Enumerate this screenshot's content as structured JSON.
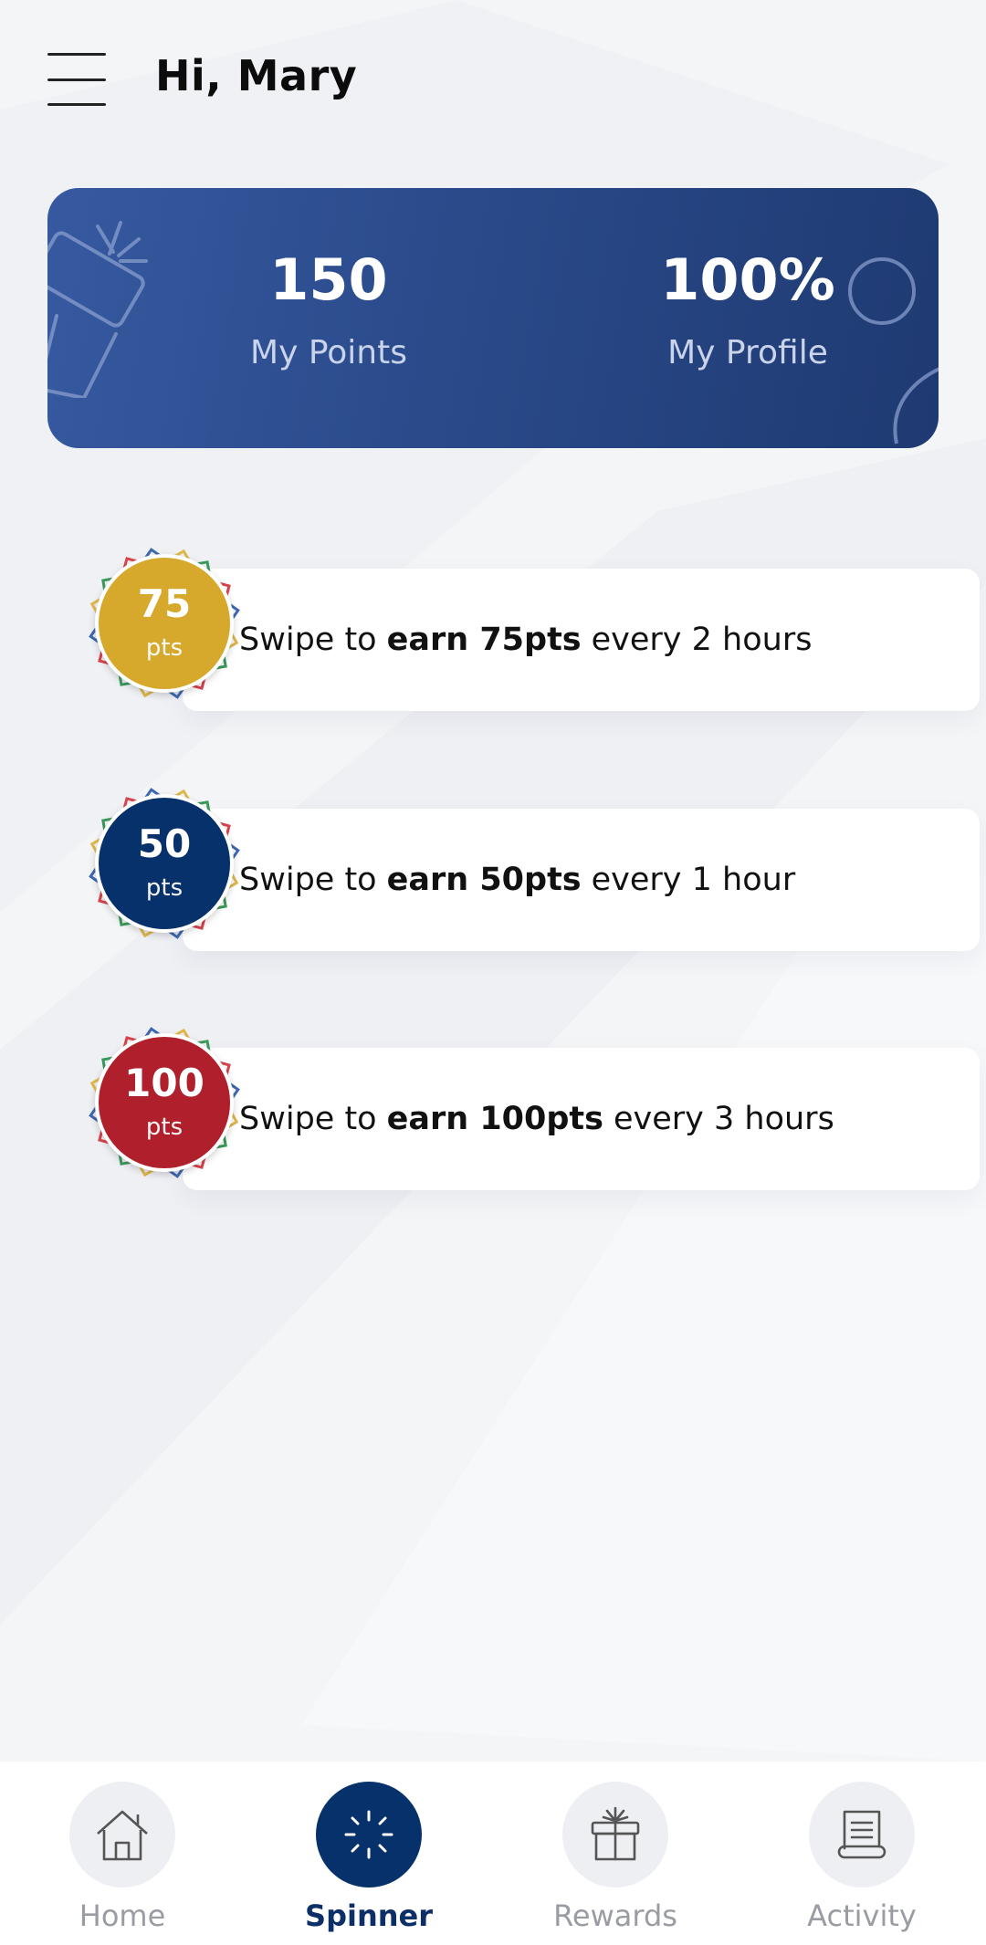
{
  "header": {
    "greeting": "Hi, Mary"
  },
  "summary": {
    "points_value": "150",
    "points_label": "My Points",
    "profile_value": "100%",
    "profile_label": "My Profile"
  },
  "spins": [
    {
      "amount": "75",
      "unit": "pts",
      "prefix": "Swipe to",
      "highlight": "earn 75pts",
      "suffix": "every 2 hours",
      "color": "#d6a82b"
    },
    {
      "amount": "50",
      "unit": "pts",
      "prefix": "Swipe to",
      "highlight": "earn 50pts",
      "suffix": "every 1 hour",
      "color": "#06316a"
    },
    {
      "amount": "100",
      "unit": "pts",
      "prefix": "Swipe to",
      "highlight": "earn 100pts",
      "suffix": "every 3 hours",
      "color": "#b0202c"
    }
  ],
  "nav": [
    {
      "label": "Home",
      "icon": "home-icon",
      "active": false
    },
    {
      "label": "Spinner",
      "icon": "spinner-icon",
      "active": true
    },
    {
      "label": "Rewards",
      "icon": "gift-icon",
      "active": false
    },
    {
      "label": "Activity",
      "icon": "receipt-icon",
      "active": false
    }
  ],
  "colors": {
    "brand_blue": "#2a4a8a",
    "nav_active": "#07316a",
    "ring_red": "#d9434c",
    "ring_blue": "#3d68b0",
    "ring_green": "#3a9a5a",
    "ring_yellow": "#e0b84a"
  }
}
